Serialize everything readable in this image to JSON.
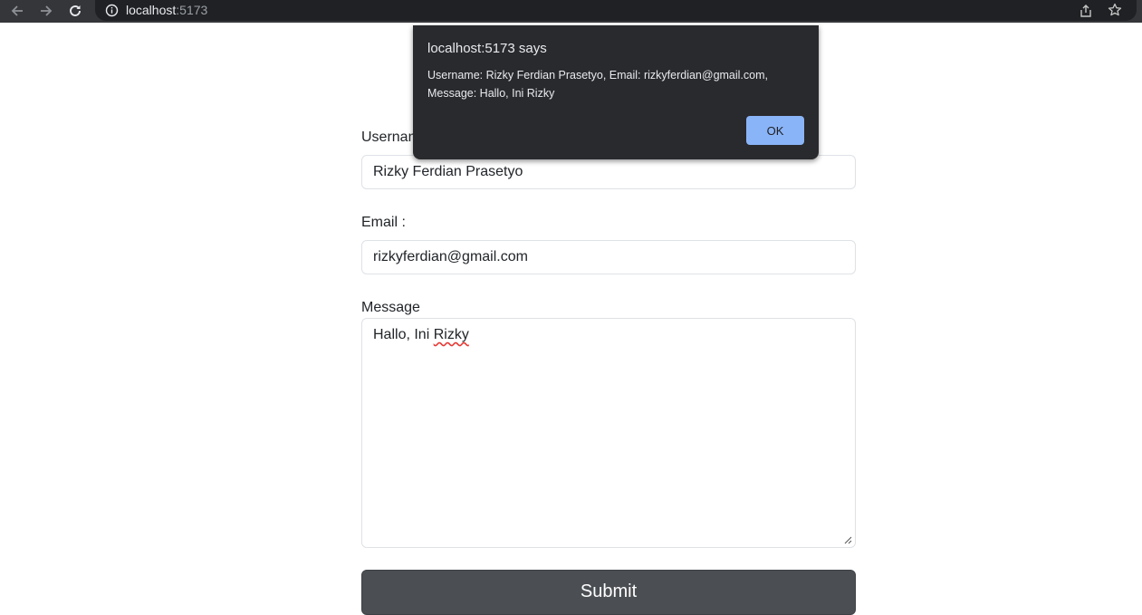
{
  "browser": {
    "url_host": "localhost",
    "url_port": ":5173",
    "back_icon": "arrow-left-icon",
    "forward_icon": "arrow-right-icon",
    "reload_icon": "reload-icon",
    "info_icon": "info-icon",
    "share_icon": "share-icon",
    "bookmark_icon": "star-icon"
  },
  "form": {
    "username_label": "Username :",
    "username_value": "Rizky Ferdian Prasetyo",
    "email_label": "Email :",
    "email_value": "rizkyferdian@gmail.com",
    "message_label": "Message",
    "message_value_prefix": "Hallo, Ini ",
    "message_value_misspelled": "Rizky",
    "submit_label": "Submit"
  },
  "alert": {
    "title": "localhost:5173 says",
    "message": "Username: Rizky Ferdian Prasetyo, Email: rizkyferdian@gmail.com, Message: Hallo, Ini Rizky",
    "ok_label": "OK"
  },
  "colors": {
    "browser_bar": "#35363a",
    "dialog_bg": "#292a2d",
    "ok_button": "#8ab4f8",
    "submit_button": "#4b4f53"
  }
}
